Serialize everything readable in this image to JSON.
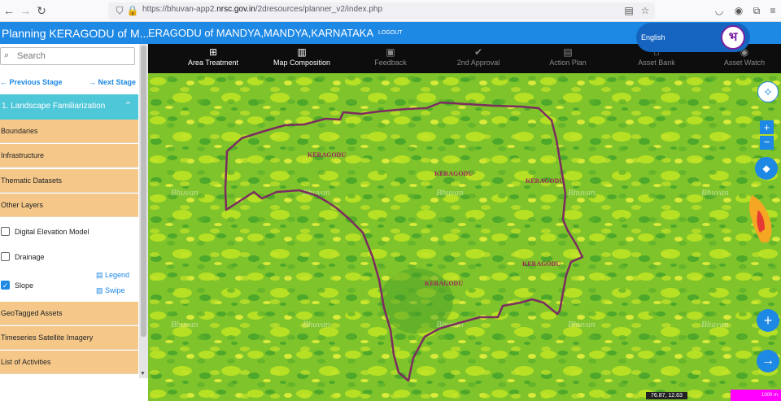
{
  "browser": {
    "url_base": "https://bhuvan-app2.",
    "url_domain": "nrsc.gov.in",
    "url_path": "/2dresources/planner_v2/index.php"
  },
  "header": {
    "sidebar_title": "Planning KERAGODU of M...",
    "main_title": "ERAGODU of MANDYA,MANDYA,KARNATAKA",
    "logout": "LOGOUT",
    "language": "English",
    "logo_char": "भ"
  },
  "toolbar": [
    {
      "label": "Area Treatment",
      "icon": "plus-square-icon",
      "active": true
    },
    {
      "label": "Map Composition",
      "icon": "map-icon",
      "active": true
    },
    {
      "label": "Feedback",
      "icon": "feedback-icon",
      "active": false
    },
    {
      "label": "2nd Approval",
      "icon": "check-circle-icon",
      "active": false
    },
    {
      "label": "Action Plan",
      "icon": "save-icon",
      "active": false
    },
    {
      "label": "Asset Bank",
      "icon": "asset-bank-icon",
      "active": false
    },
    {
      "label": "Asset Watch",
      "icon": "eye-icon",
      "active": false
    }
  ],
  "sidebar": {
    "search_placeholder": "Search",
    "prev_stage": "Previous Stage",
    "next_stage": "Next Stage",
    "section": "1. Landscape Familiarization",
    "categories_top": [
      "Boundaries",
      "Infrastructure",
      "Thematic Datasets",
      "Other Layers"
    ],
    "layers": [
      {
        "label": "Digital Elevation Model",
        "checked": false
      },
      {
        "label": "Drainage",
        "checked": false
      },
      {
        "label": "Slope",
        "checked": true
      }
    ],
    "legend": "Legend",
    "swipe": "Swipe",
    "categories_bottom": [
      "GeoTagged Assets",
      "Timeseries Satellite Imagery",
      "List of Activities"
    ]
  },
  "map": {
    "labels": [
      "KERAGODU",
      "KERAGODU",
      "KERAGODU",
      "KERAGODU",
      "KERAGODU"
    ],
    "watermark": "Bhuvan",
    "coordinates": "76.87, 12.63",
    "scale": "1000 m",
    "boundary_color": "#7b2d5f"
  }
}
